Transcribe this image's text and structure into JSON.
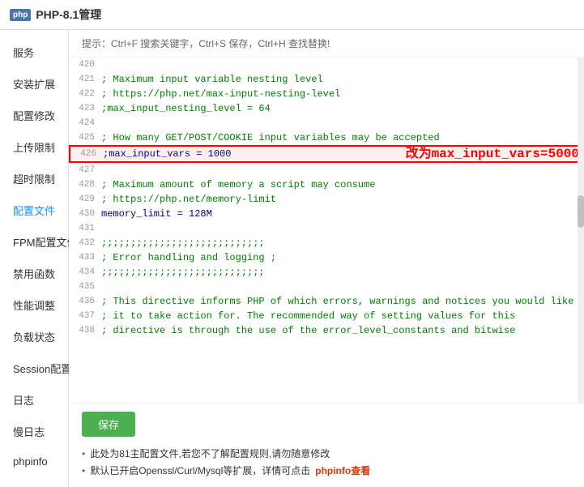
{
  "app": {
    "title": "PHP-8.1管理",
    "php_badge": "php"
  },
  "hint": {
    "text": "提示：Ctrl+F 搜索关键字，Ctrl+S 保存，Ctrl+H 查找替换!"
  },
  "sidebar": {
    "items": [
      {
        "label": "服务",
        "active": false
      },
      {
        "label": "安装扩展",
        "active": false
      },
      {
        "label": "配置修改",
        "active": false
      },
      {
        "label": "上传限制",
        "active": false
      },
      {
        "label": "超时限制",
        "active": false
      },
      {
        "label": "配置文件",
        "active": true
      },
      {
        "label": "FPM配置文件",
        "active": false
      },
      {
        "label": "禁用函数",
        "active": false
      },
      {
        "label": "性能调整",
        "active": false
      },
      {
        "label": "负载状态",
        "active": false
      },
      {
        "label": "Session配置",
        "active": false
      },
      {
        "label": "日志",
        "active": false
      },
      {
        "label": "慢日志",
        "active": false
      },
      {
        "label": "phpinfo",
        "active": false
      }
    ]
  },
  "editor": {
    "lines": [
      {
        "num": "420",
        "content": "",
        "type": "normal"
      },
      {
        "num": "421",
        "content": "; Maximum input variable nesting level",
        "type": "comment"
      },
      {
        "num": "422",
        "content": "; https://php.net/max-input-nesting-level",
        "type": "url"
      },
      {
        "num": "423",
        "content": ";max_input_nesting_level = 64",
        "type": "comment"
      },
      {
        "num": "424",
        "content": "",
        "type": "normal"
      },
      {
        "num": "425",
        "content": "; How many GET/POST/COOKIE input variables may be accepted",
        "type": "comment"
      },
      {
        "num": "426",
        "content": ";max_input_vars = 1000",
        "type": "highlight",
        "annotation": "改为max_input_vars=5000"
      },
      {
        "num": "427",
        "content": "",
        "type": "normal"
      },
      {
        "num": "428",
        "content": "; Maximum amount of memory a script may consume",
        "type": "comment"
      },
      {
        "num": "429",
        "content": "; https://php.net/memory-limit",
        "type": "url"
      },
      {
        "num": "430",
        "content": "memory_limit = 128M",
        "type": "directive"
      },
      {
        "num": "431",
        "content": "",
        "type": "normal"
      },
      {
        "num": "432",
        "content": ";;;;;;;;;;;;;;;;;;;;;;;;;;;;",
        "type": "comment"
      },
      {
        "num": "433",
        "content": "; Error handling and logging ;",
        "type": "comment"
      },
      {
        "num": "434",
        "content": ";;;;;;;;;;;;;;;;;;;;;;;;;;;;",
        "type": "comment"
      },
      {
        "num": "435",
        "content": "",
        "type": "normal"
      },
      {
        "num": "436",
        "content": "; This directive informs PHP of which errors, warnings and notices you would like",
        "type": "comment"
      },
      {
        "num": "437",
        "content": "; it to take action for. The recommended way of setting values for this",
        "type": "comment"
      },
      {
        "num": "438",
        "content": "; directive is through the use of the error_level_constants and bitwise",
        "type": "comment"
      }
    ]
  },
  "save_button": "保存",
  "notes": [
    {
      "text": "此处为81主配置文件,若您不了解配置规则,请勿随意修改"
    },
    {
      "text": "默认已开启Openssl/Curl/Mysql等扩展，详情可点击",
      "link": "phpinfo查看",
      "link_label": "phpinfo"
    }
  ]
}
